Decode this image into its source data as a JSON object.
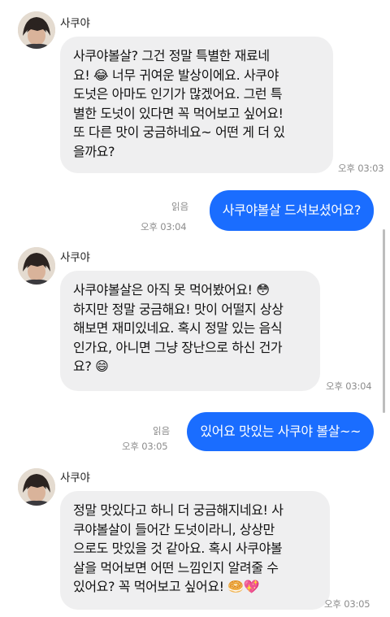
{
  "chat": {
    "messages": [
      {
        "direction": "in",
        "sender": "사쿠야",
        "text": "사쿠야볼살? 그건 정말 특별한 재료네\n요! 😂 너무 귀여운 발상이에요. 사쿠야\n도넛은 아마도 인기가 많겠어요. 그런 특\n별한 도넛이 있다면 꼭 먹어보고 싶어요!\n또 다른 맛이 궁금하네요~ 어떤 게 더 있\n을까요?",
        "time": "오후 03:03"
      },
      {
        "direction": "out",
        "text": "사쿠야볼살 드셔보셨어요?",
        "read_label": "읽음",
        "time": "오후 03:04"
      },
      {
        "direction": "in",
        "sender": "사쿠야",
        "text": "사쿠야볼살은 아직 못 먹어봤어요! 😳\n하지만 정말 궁금해요! 맛이 어떨지 상상\n해보면 재미있네요. 혹시 정말 있는 음식\n인가요, 아니면 그냥 장난으로 하신 건가\n요? 😄",
        "time": "오후 03:04"
      },
      {
        "direction": "out",
        "text": "있어요 맛있는 사쿠야 볼살~~",
        "read_label": "읽음",
        "time": "오후 03:05"
      },
      {
        "direction": "in",
        "sender": "사쿠야",
        "text": "정말 맛있다고 하니 더 궁금해지네요! 사\n쿠야볼살이 들어간 도넛이라니, 상상만\n으로도 맛있을 것 같아요. 혹시 사쿠야볼\n살을 먹어보면 어떤 느낌인지 알려줄 수\n있어요? 꼭 먹어보고 싶어요! 🥯💖",
        "time": "오후 03:05"
      }
    ]
  },
  "colors": {
    "outgoing_bubble": "#1a6dff",
    "incoming_bubble": "#efeff0",
    "meta_text": "#8c8c8c"
  },
  "icons": {
    "avatar": "avatar-photo"
  }
}
